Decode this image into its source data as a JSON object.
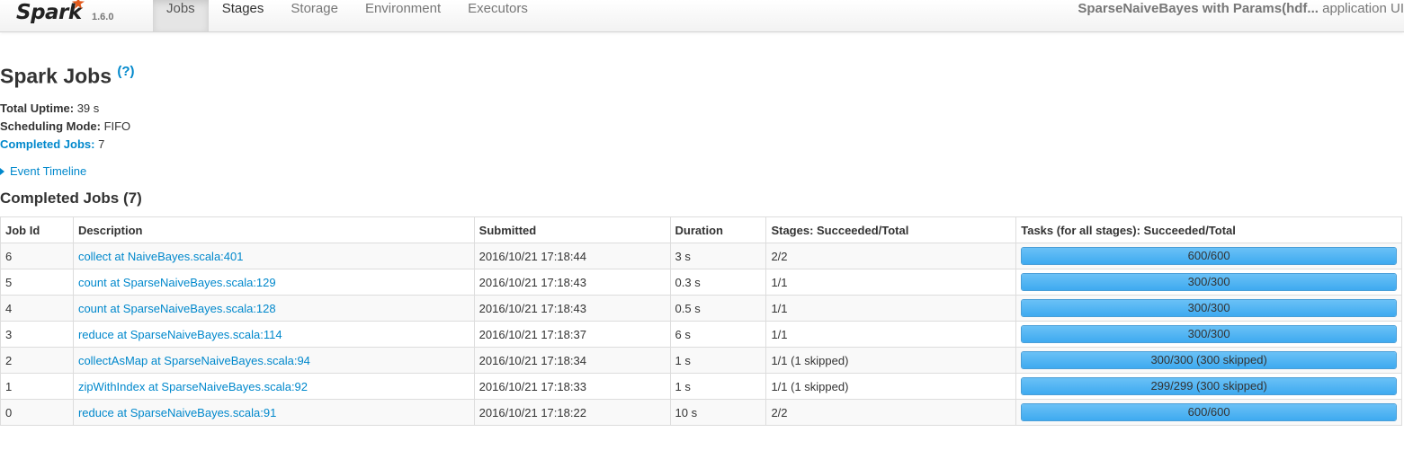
{
  "navbar": {
    "brand": "Spark",
    "version": "1.6.0",
    "tabs": [
      "Jobs",
      "Stages",
      "Storage",
      "Environment",
      "Executors"
    ],
    "active_tab": "Jobs",
    "app_name": "SparseNaiveBayes with Params(hdf...",
    "app_suffix": " application UI"
  },
  "page": {
    "title": "Spark Jobs",
    "help": "(?)",
    "uptime_label": "Total Uptime:",
    "uptime_value": " 39 s",
    "mode_label": "Scheduling Mode:",
    "mode_value": " FIFO",
    "completed_label": "Completed Jobs:",
    "completed_value": " 7",
    "event_timeline": "Event Timeline",
    "section_title": "Completed Jobs (7)"
  },
  "table": {
    "headers": [
      "Job Id",
      "Description",
      "Submitted",
      "Duration",
      "Stages: Succeeded/Total",
      "Tasks (for all stages): Succeeded/Total"
    ],
    "rows": [
      {
        "id": "6",
        "desc": "collect at NaiveBayes.scala:401",
        "submitted": "2016/10/21 17:18:44",
        "duration": "3 s",
        "stages": "2/2",
        "tasks": "600/600",
        "progress": 1.0
      },
      {
        "id": "5",
        "desc": "count at SparseNaiveBayes.scala:129",
        "submitted": "2016/10/21 17:18:43",
        "duration": "0.3 s",
        "stages": "1/1",
        "tasks": "300/300",
        "progress": 1.0
      },
      {
        "id": "4",
        "desc": "count at SparseNaiveBayes.scala:128",
        "submitted": "2016/10/21 17:18:43",
        "duration": "0.5 s",
        "stages": "1/1",
        "tasks": "300/300",
        "progress": 1.0
      },
      {
        "id": "3",
        "desc": "reduce at SparseNaiveBayes.scala:114",
        "submitted": "2016/10/21 17:18:37",
        "duration": "6 s",
        "stages": "1/1",
        "tasks": "300/300",
        "progress": 1.0
      },
      {
        "id": "2",
        "desc": "collectAsMap at SparseNaiveBayes.scala:94",
        "submitted": "2016/10/21 17:18:34",
        "duration": "1 s",
        "stages": "1/1 (1 skipped)",
        "tasks": "300/300 (300 skipped)",
        "progress": 1.0
      },
      {
        "id": "1",
        "desc": "zipWithIndex at SparseNaiveBayes.scala:92",
        "submitted": "2016/10/21 17:18:33",
        "duration": "1 s",
        "stages": "1/1 (1 skipped)",
        "tasks": "299/299 (300 skipped)",
        "progress": 1.0
      },
      {
        "id": "0",
        "desc": "reduce at SparseNaiveBayes.scala:91",
        "submitted": "2016/10/21 17:18:22",
        "duration": "10 s",
        "stages": "2/2",
        "tasks": "600/600",
        "progress": 1.0
      }
    ]
  },
  "colors": {
    "link": "#0088cc",
    "bar_fill": "#3eaaf0",
    "brand_star": "#e25a1c"
  }
}
